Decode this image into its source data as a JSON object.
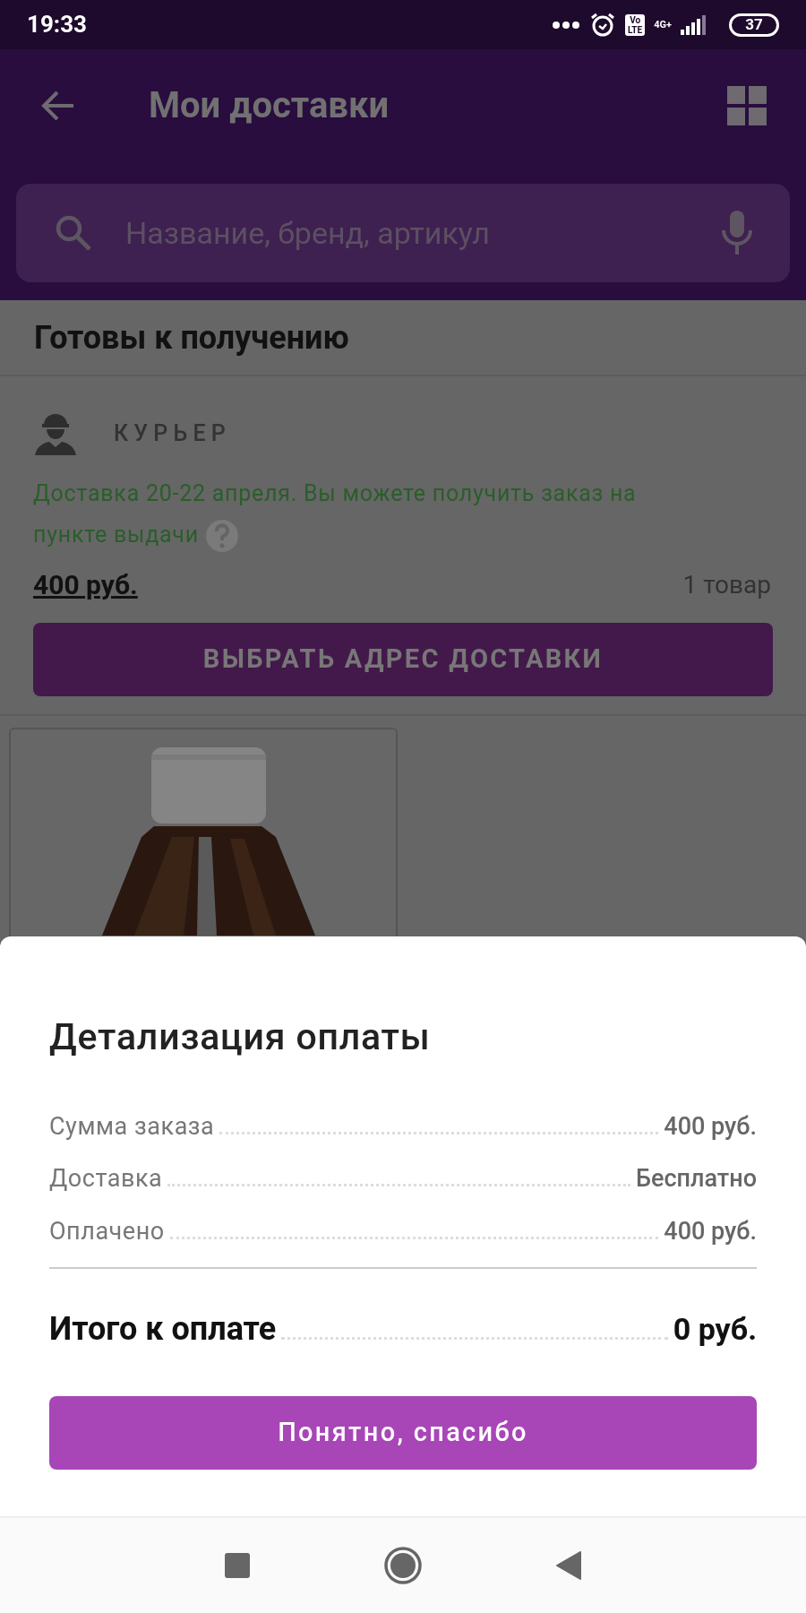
{
  "status_bar": {
    "time": "19:33",
    "volte": "Vo\nLTE",
    "network": "4G+",
    "battery": "37"
  },
  "app_bar": {
    "title": "Мои доставки"
  },
  "search": {
    "placeholder": "Название, бренд, артикул"
  },
  "section": {
    "title": "Готовы к получению"
  },
  "delivery": {
    "method": "КУРЬЕР",
    "note": "Доставка 20-22 апреля. Вы можете получить заказ на пункте выдачи",
    "price": "400 руб.",
    "count": "1 товар",
    "button": "ВЫБРАТЬ АДРЕС ДОСТАВКИ"
  },
  "sheet": {
    "title": "Детализация оплаты",
    "rows": [
      {
        "label": "Сумма заказа",
        "value": "400 руб."
      },
      {
        "label": "Доставка",
        "value": "Бесплатно"
      },
      {
        "label": "Оплачено",
        "value": "400 руб."
      }
    ],
    "total": {
      "label": "Итого к оплате",
      "value": "0 руб."
    },
    "button": "Понятно, спасибо"
  }
}
